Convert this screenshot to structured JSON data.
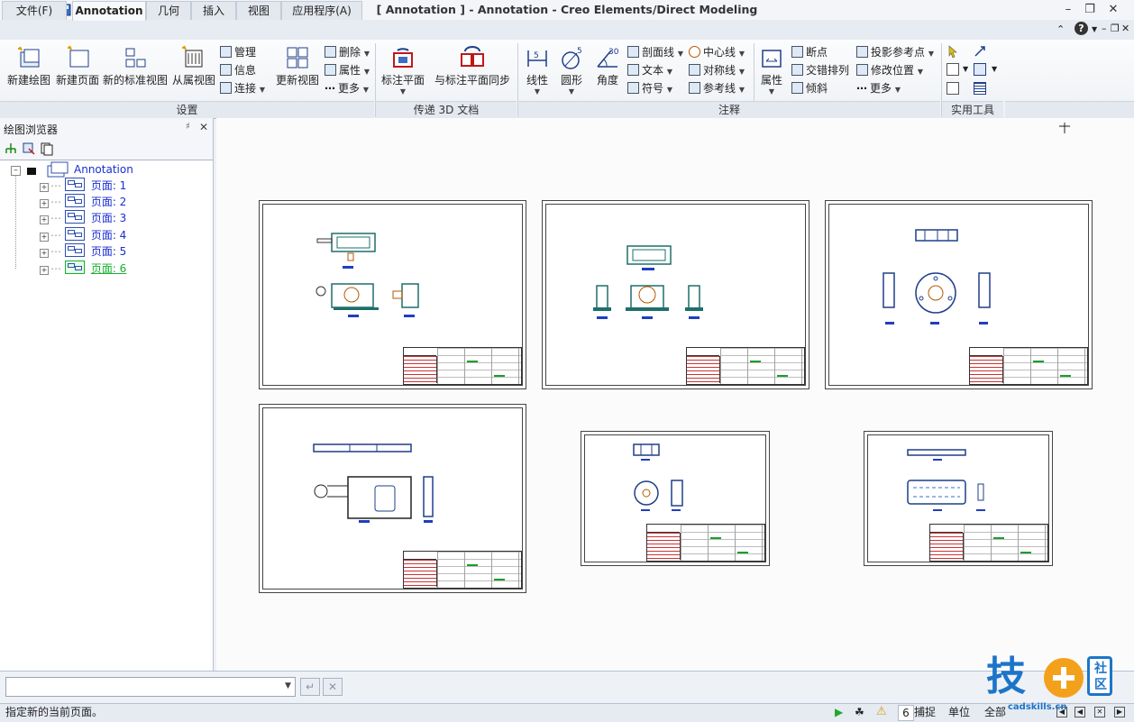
{
  "window": {
    "title": "[ Annotation ] - Annotation - Creo Elements/Direct Modeling"
  },
  "tabs": [
    {
      "label": "文件(F)"
    },
    {
      "label": "Annotation"
    },
    {
      "label": "几何"
    },
    {
      "label": "插入"
    },
    {
      "label": "视图"
    },
    {
      "label": "应用程序(A)"
    }
  ],
  "ribbon": {
    "groups": {
      "settings": "设置",
      "transfer": "传递 3D 文档",
      "annotate": "注释",
      "utilities": "实用工具"
    },
    "big_buttons": {
      "new_drawing": "新建绘图",
      "new_page": "新建页面",
      "new_std_view": "新的标准视图",
      "from_view": "从属视图",
      "update_view": "更新视图",
      "annot_plane": "标注平面",
      "sync_plane": "与标注平面同步",
      "linear": "线性",
      "circle": "圆形",
      "angle": "角度",
      "properties": "属性"
    },
    "small_buttons": {
      "manage": "管理",
      "info": "信息",
      "connect": "连接",
      "delete": "删除",
      "attr": "属性",
      "more1": "更多",
      "section_line": "剖面线",
      "text": "文本",
      "symbol": "符号",
      "center_line": "中心线",
      "symmetry_line": "对称线",
      "ref_line": "参考线",
      "break_point": "断点",
      "cross_arrange": "交错排列",
      "tilt": "倾斜",
      "proj_ref_point": "投影参考点",
      "modify_pos": "修改位置",
      "more2": "更多"
    },
    "icon_labels": {
      "linear_num": "5",
      "circle_num": "5",
      "angle_num": "30"
    }
  },
  "browser": {
    "title": "绘图浏览器",
    "root": "Annotation",
    "pages": [
      {
        "label": "页面: 1",
        "current": false
      },
      {
        "label": "页面: 2",
        "current": false
      },
      {
        "label": "页面: 3",
        "current": false
      },
      {
        "label": "页面: 4",
        "current": false
      },
      {
        "label": "页面: 5",
        "current": false
      },
      {
        "label": "页面: 6",
        "current": true
      }
    ]
  },
  "status": {
    "message": "指定新的当前页面。",
    "count": "6",
    "snap": "捕捉",
    "unit": "单位",
    "all": "全部"
  },
  "watermark": {
    "text": "技",
    "side_top": "社",
    "side_bottom": "区",
    "url": "cadskills.cn"
  },
  "colors": {
    "accent_blue": "#1a2fd0",
    "current_page_green": "#18b030",
    "titleblock_red": "#cc3333"
  }
}
